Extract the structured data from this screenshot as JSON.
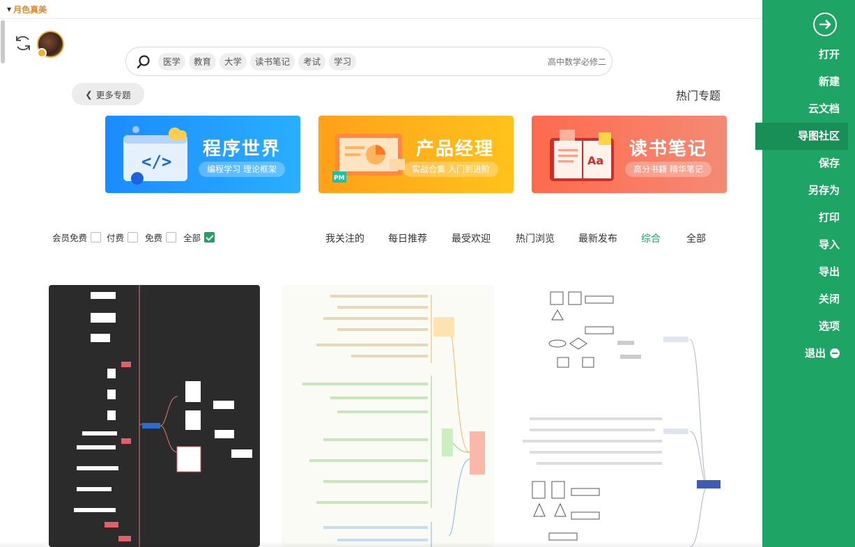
{
  "topbar": {
    "theme_label": "月色真美"
  },
  "search": {
    "placeholder": "高中数学必修二",
    "tags": [
      "学习",
      "考试",
      "读书笔记",
      "大学",
      "教育",
      "医学"
    ]
  },
  "hot_topics": {
    "title": "热门专题",
    "more_label": "更多专题"
  },
  "banners": [
    {
      "title": "读书笔记",
      "subtitle": "高分书籍 精华笔记",
      "color": "#ff6a4d"
    },
    {
      "title": "产品经理",
      "subtitle": "实战合集 入门到进阶",
      "color": "#ffa11a"
    },
    {
      "title": "程序世界",
      "subtitle": "编程学习 理论框架",
      "color": "#1a8cff"
    }
  ],
  "filter_tabs": [
    "全部",
    "综合",
    "最新发布",
    "热门浏览",
    "最受欢迎",
    "每日推荐",
    "我关注的"
  ],
  "active_tab": "综合",
  "price_filters": [
    "全部",
    "免费",
    "付费",
    "会员免费"
  ],
  "sidebar": {
    "items": [
      "打开",
      "新建",
      "云文档",
      "导图社区",
      "保存",
      "另存为",
      "打印",
      "导入",
      "导出",
      "关闭",
      "选项",
      "退出"
    ],
    "active": "导图社区",
    "accent": "#1ea565"
  },
  "cards": [
    {
      "theme": "dark-mindmap",
      "background": "#2b2b2b"
    },
    {
      "theme": "pastel-mindmap",
      "background": "#fbfbf6"
    },
    {
      "theme": "white-mindmap",
      "background": "#ffffff"
    }
  ]
}
